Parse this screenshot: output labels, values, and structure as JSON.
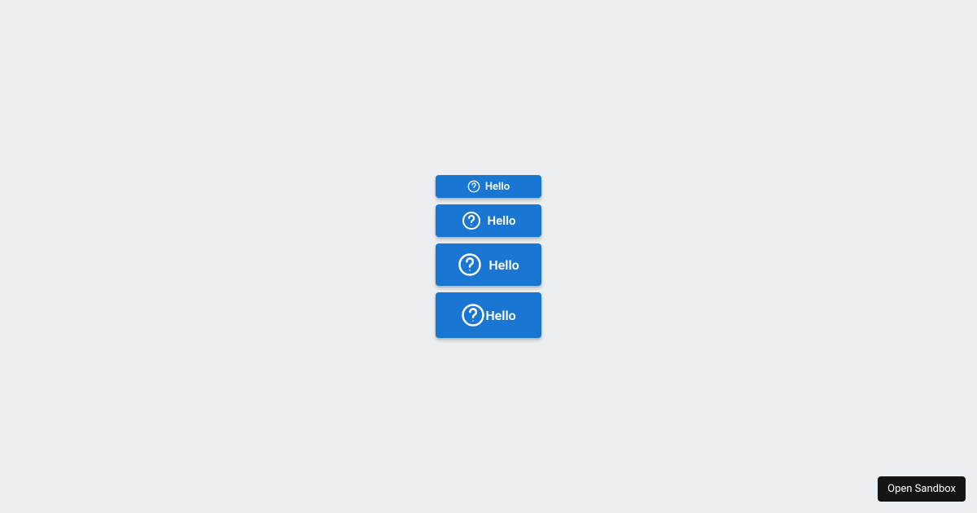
{
  "buttons": [
    {
      "label": "Hello",
      "size": "small",
      "icon_size": 16
    },
    {
      "label": "Hello",
      "size": "medium",
      "icon_size": 24
    },
    {
      "label": "Hello",
      "size": "large",
      "icon_size": 30
    },
    {
      "label": "Hello",
      "size": "xlarge",
      "icon_size": 30
    }
  ],
  "footer": {
    "open_sandbox_label": "Open Sandbox"
  },
  "colors": {
    "background": "#ECEFF1",
    "button_bg": "#1976D2",
    "button_fg": "#FFFFFF",
    "sandbox_bg": "#151515"
  }
}
